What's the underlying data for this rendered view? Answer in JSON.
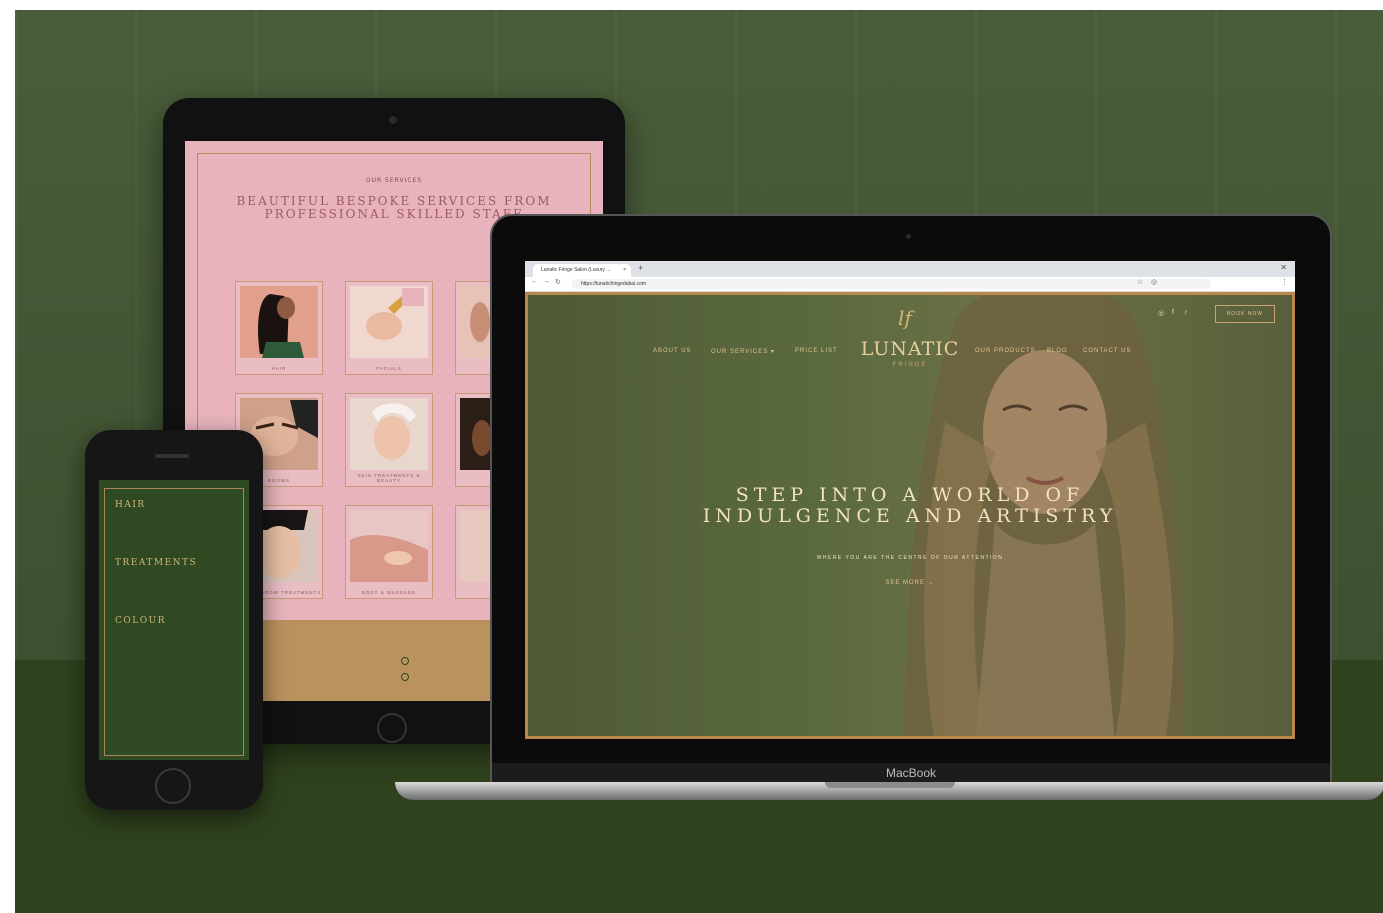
{
  "tablet": {
    "kicker": "OUR SERVICES",
    "heading": "BEAUTIFUL BESPOKE SERVICES FROM PROFESSIONAL SKILLED STAFF",
    "services": [
      "HAIR",
      "FACIALS",
      "BROWS",
      "SKIN TREATMENTS & BEAUTY",
      "LASH & BROW TREATMENTS",
      "BODY & MASSAGE"
    ]
  },
  "phone": {
    "sections": [
      "HAIR",
      "TREATMENTS",
      "COLOUR"
    ]
  },
  "browser": {
    "tab_title": "Lunatic Fringe Salon (Luxury ...",
    "tab_close": "×",
    "new_tab": "+",
    "url": "https://lunaticfringedubai.com"
  },
  "site": {
    "monogram": "lf",
    "logo": "LUNATIC",
    "logo_sub": "FRINGE",
    "nav_left": [
      "ABOUT US",
      "OUR SERVICES ▾",
      "PRICE LIST"
    ],
    "nav_right": [
      "OUR PRODUCTS",
      "BLOG",
      "CONTACT US"
    ],
    "book_button": "BOOK NOW",
    "hero_title_line1": "STEP INTO A WORLD OF",
    "hero_title_line2": "INDULGENCE AND ARTISTRY",
    "hero_subtitle": "WHERE YOU ARE THE CENTRE OF OUR ATTENTION",
    "hero_cta": "SEE MORE →"
  },
  "laptop_brand": "MacBook",
  "colors": {
    "background_green": "#3f5230",
    "gold_accent": "#c7a36e",
    "tablet_pink": "#e8b3bd"
  }
}
